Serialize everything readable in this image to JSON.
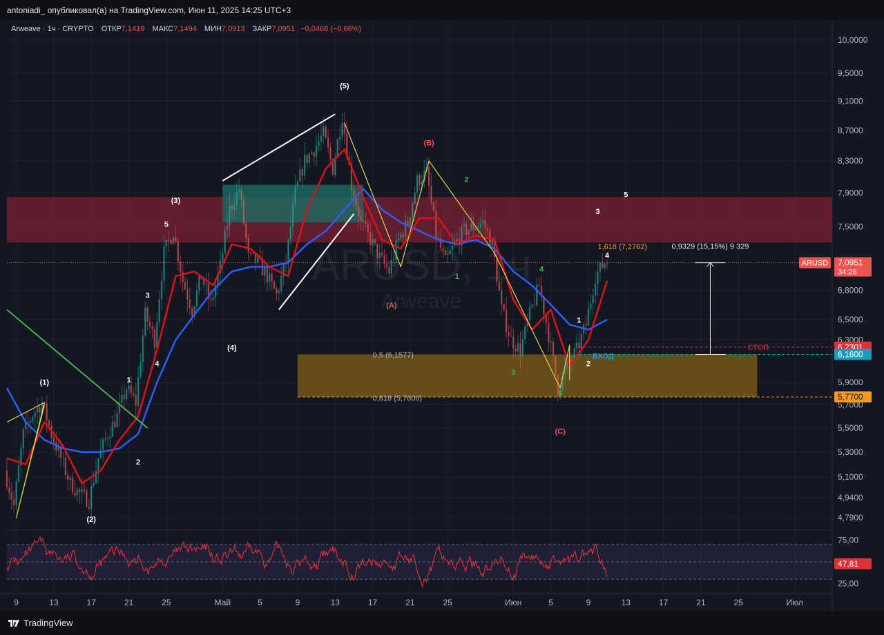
{
  "header": {
    "publisher_line": "antoniadi_ опубликовал(а) на TradingView.com, Июн 11, 2025 14:25 UTC+3"
  },
  "legend": {
    "symbol": "Arweave · 1ч · CRYPTO",
    "open_label": "ОТКР",
    "open": "7,1419",
    "high_label": "МАКС",
    "high": "7,1494",
    "low_label": "МИН",
    "low": "7,0913",
    "close_label": "ЗАКР",
    "close": "7,0951",
    "change": "−0,0468 (−0,66%)"
  },
  "watermark": {
    "ticker": "ARUSD, 1ч",
    "name": "Arweave"
  },
  "brand": {
    "name": "TradingView"
  },
  "colors": {
    "background": "#131722",
    "ema_fast": "#e0101a",
    "ema_slow": "#2f5bff",
    "resistance_zone": "#7a2232",
    "teal_zone": "#1b6b63",
    "buy_zone": "#7a5a18",
    "rsi_line": "#e0303a",
    "wave_line": "#e3d646",
    "trend_line": "#ffffff",
    "price_tag": "#ef5350",
    "entry_tag": "#1e9bbc",
    "stop_tag": "#e0303a",
    "fib_tag": "#f79a1e"
  },
  "chart_data": {
    "type": "candlestick",
    "symbol": "ARUSD",
    "timeframe": "1ч",
    "y_scale": "log",
    "ylim": [
      4.7,
      10.3
    ],
    "x_date_range": [
      "2025-04-08",
      "2025-07-05"
    ],
    "x_ticks": [
      {
        "date": "2025-04-09",
        "label": "9"
      },
      {
        "date": "2025-04-13",
        "label": "13"
      },
      {
        "date": "2025-04-17",
        "label": "17"
      },
      {
        "date": "2025-04-21",
        "label": "21"
      },
      {
        "date": "2025-04-25",
        "label": "25"
      },
      {
        "date": "2025-05-01",
        "label": "Май"
      },
      {
        "date": "2025-05-05",
        "label": "5"
      },
      {
        "date": "2025-05-09",
        "label": "9"
      },
      {
        "date": "2025-05-13",
        "label": "13"
      },
      {
        "date": "2025-05-17",
        "label": "17"
      },
      {
        "date": "2025-05-21",
        "label": "21"
      },
      {
        "date": "2025-05-25",
        "label": "25"
      },
      {
        "date": "2025-06-01",
        "label": "Июн"
      },
      {
        "date": "2025-06-05",
        "label": "5"
      },
      {
        "date": "2025-06-09",
        "label": "9"
      },
      {
        "date": "2025-06-13",
        "label": "13"
      },
      {
        "date": "2025-06-17",
        "label": "17"
      },
      {
        "date": "2025-06-21",
        "label": "21"
      },
      {
        "date": "2025-06-25",
        "label": "25"
      },
      {
        "date": "2025-07-01",
        "label": "Июл"
      }
    ],
    "y_ticks": [
      "10,0000",
      "9,5000",
      "9,1000",
      "8,7000",
      "8,3000",
      "7,9000",
      "7,5000",
      "6,8000",
      "6,5000",
      "6,3000",
      "5,9000",
      "5,7000",
      "5,5000",
      "5,3000",
      "5,1000",
      "4,9400",
      "4,7900"
    ],
    "y_tick_values": [
      10.0,
      9.5,
      9.1,
      8.7,
      8.3,
      7.9,
      7.5,
      6.8,
      6.5,
      6.3,
      5.9,
      5.7,
      5.5,
      5.3,
      5.1,
      4.94,
      4.79
    ],
    "price_path": [
      [
        "2025-04-08",
        5.15
      ],
      [
        "2025-04-09",
        4.88
      ],
      [
        "2025-04-10",
        5.45
      ],
      [
        "2025-04-11",
        5.62
      ],
      [
        "2025-04-12",
        5.72
      ],
      [
        "2025-04-13",
        5.45
      ],
      [
        "2025-04-14",
        5.25
      ],
      [
        "2025-04-15",
        5.05
      ],
      [
        "2025-04-16",
        4.97
      ],
      [
        "2025-04-17",
        4.92
      ],
      [
        "2025-04-18",
        5.25
      ],
      [
        "2025-04-19",
        5.45
      ],
      [
        "2025-04-20",
        5.6
      ],
      [
        "2025-04-21",
        5.85
      ],
      [
        "2025-04-22",
        5.72
      ],
      [
        "2025-04-23",
        6.55
      ],
      [
        "2025-04-24",
        6.3
      ],
      [
        "2025-04-25",
        7.2
      ],
      [
        "2025-04-26",
        7.45
      ],
      [
        "2025-04-27",
        6.9
      ],
      [
        "2025-04-28",
        6.6
      ],
      [
        "2025-04-29",
        6.95
      ],
      [
        "2025-04-30",
        6.65
      ],
      [
        "2025-05-01",
        7.05
      ],
      [
        "2025-05-02",
        7.7
      ],
      [
        "2025-05-03",
        7.95
      ],
      [
        "2025-05-04",
        7.15
      ],
      [
        "2025-05-05",
        7.1
      ],
      [
        "2025-05-06",
        6.95
      ],
      [
        "2025-05-07",
        6.75
      ],
      [
        "2025-05-08",
        7.1
      ],
      [
        "2025-05-09",
        7.9
      ],
      [
        "2025-05-10",
        8.3
      ],
      [
        "2025-05-11",
        8.45
      ],
      [
        "2025-05-12",
        8.65
      ],
      [
        "2025-05-13",
        8.2
      ],
      [
        "2025-05-14",
        8.9
      ],
      [
        "2025-05-15",
        8.0
      ],
      [
        "2025-05-16",
        7.55
      ],
      [
        "2025-05-17",
        7.35
      ],
      [
        "2025-05-18",
        7.15
      ],
      [
        "2025-05-19",
        7.0
      ],
      [
        "2025-05-20",
        7.35
      ],
      [
        "2025-05-21",
        7.55
      ],
      [
        "2025-05-22",
        8.05
      ],
      [
        "2025-05-23",
        8.15
      ],
      [
        "2025-05-24",
        7.4
      ],
      [
        "2025-05-25",
        7.1
      ],
      [
        "2025-05-26",
        7.3
      ],
      [
        "2025-05-27",
        7.45
      ],
      [
        "2025-05-28",
        7.5
      ],
      [
        "2025-05-29",
        7.55
      ],
      [
        "2025-05-30",
        7.3
      ],
      [
        "2025-05-31",
        6.6
      ],
      [
        "2025-06-01",
        6.3
      ],
      [
        "2025-06-02",
        6.2
      ],
      [
        "2025-06-03",
        6.55
      ],
      [
        "2025-06-04",
        6.85
      ],
      [
        "2025-06-05",
        6.35
      ],
      [
        "2025-06-06",
        5.85
      ],
      [
        "2025-06-07",
        6.05
      ],
      [
        "2025-06-08",
        6.2
      ],
      [
        "2025-06-09",
        6.45
      ],
      [
        "2025-06-10",
        6.95
      ],
      [
        "2025-06-11",
        7.1
      ]
    ],
    "ema_fast_path": [
      [
        "2025-04-08",
        5.25
      ],
      [
        "2025-04-10",
        5.2
      ],
      [
        "2025-04-12",
        5.55
      ],
      [
        "2025-04-14",
        5.35
      ],
      [
        "2025-04-16",
        5.05
      ],
      [
        "2025-04-18",
        5.15
      ],
      [
        "2025-04-20",
        5.4
      ],
      [
        "2025-04-22",
        5.6
      ],
      [
        "2025-04-24",
        6.2
      ],
      [
        "2025-04-26",
        6.95
      ],
      [
        "2025-04-28",
        7.0
      ],
      [
        "2025-04-30",
        6.85
      ],
      [
        "2025-05-02",
        7.3
      ],
      [
        "2025-05-04",
        7.25
      ],
      [
        "2025-05-06",
        7.05
      ],
      [
        "2025-05-08",
        6.95
      ],
      [
        "2025-05-10",
        7.7
      ],
      [
        "2025-05-12",
        8.2
      ],
      [
        "2025-05-14",
        8.45
      ],
      [
        "2025-05-16",
        7.85
      ],
      [
        "2025-05-18",
        7.35
      ],
      [
        "2025-05-20",
        7.25
      ],
      [
        "2025-05-22",
        7.6
      ],
      [
        "2025-05-24",
        7.6
      ],
      [
        "2025-05-26",
        7.3
      ],
      [
        "2025-05-28",
        7.4
      ],
      [
        "2025-05-30",
        7.35
      ],
      [
        "2025-06-01",
        6.7
      ],
      [
        "2025-06-03",
        6.4
      ],
      [
        "2025-06-05",
        6.6
      ],
      [
        "2025-06-07",
        6.05
      ],
      [
        "2025-06-09",
        6.3
      ],
      [
        "2025-06-11",
        6.9
      ]
    ],
    "ema_slow_path": [
      [
        "2025-04-08",
        5.85
      ],
      [
        "2025-04-10",
        5.55
      ],
      [
        "2025-04-12",
        5.4
      ],
      [
        "2025-04-14",
        5.33
      ],
      [
        "2025-04-16",
        5.3
      ],
      [
        "2025-04-18",
        5.3
      ],
      [
        "2025-04-20",
        5.33
      ],
      [
        "2025-04-22",
        5.45
      ],
      [
        "2025-04-24",
        5.9
      ],
      [
        "2025-04-26",
        6.3
      ],
      [
        "2025-04-28",
        6.55
      ],
      [
        "2025-04-30",
        6.8
      ],
      [
        "2025-05-02",
        7.0
      ],
      [
        "2025-05-04",
        7.05
      ],
      [
        "2025-05-06",
        7.05
      ],
      [
        "2025-05-08",
        7.1
      ],
      [
        "2025-05-10",
        7.3
      ],
      [
        "2025-05-12",
        7.45
      ],
      [
        "2025-05-14",
        7.7
      ],
      [
        "2025-05-16",
        7.95
      ],
      [
        "2025-05-18",
        7.7
      ],
      [
        "2025-05-20",
        7.55
      ],
      [
        "2025-05-22",
        7.45
      ],
      [
        "2025-05-24",
        7.35
      ],
      [
        "2025-05-26",
        7.3
      ],
      [
        "2025-05-28",
        7.35
      ],
      [
        "2025-05-30",
        7.25
      ],
      [
        "2025-06-01",
        7.0
      ],
      [
        "2025-06-03",
        6.85
      ],
      [
        "2025-06-05",
        6.65
      ],
      [
        "2025-06-07",
        6.45
      ],
      [
        "2025-06-09",
        6.4
      ],
      [
        "2025-06-11",
        6.5
      ]
    ],
    "zones": [
      {
        "name": "resistance",
        "from": "2025-04-08",
        "to": "2025-07-05",
        "low": 7.32,
        "high": 7.85
      },
      {
        "name": "teal",
        "from": "2025-05-01",
        "to": "2025-05-16",
        "low": 7.55,
        "high": 8.0
      },
      {
        "name": "buy",
        "from": "2025-05-09",
        "to": "2025-06-27",
        "low": 5.77,
        "high": 6.16
      }
    ],
    "levels": [
      {
        "name": "current",
        "value": 7.0951,
        "label": "ARUSD",
        "value_label": "7,0951",
        "countdown": "34:26"
      },
      {
        "name": "stop",
        "value": 6.2301,
        "label": "СТОП",
        "value_label": "6,2301"
      },
      {
        "name": "entry",
        "value": 6.16,
        "label": "ВХОД",
        "value_label": "6,1600"
      },
      {
        "name": "target",
        "value": 5.77,
        "value_label": "5,7700"
      }
    ],
    "fib_labels": [
      {
        "date": "2025-05-17",
        "value": 6.1577,
        "text": "0,5 (6,1577)"
      },
      {
        "date": "2025-05-17",
        "value": 5.7608,
        "text": "0,618 (5,7608)"
      },
      {
        "date": "2025-06-10",
        "value": 7.2762,
        "text": "1,618 (7,2762)"
      }
    ],
    "measure": {
      "date": "2025-06-22",
      "from": 6.16,
      "to": 7.0951,
      "text": "0,9329 (15,15%) 9 329"
    },
    "wave_labels": [
      {
        "text": "(1)",
        "date": "2025-04-12",
        "value": 5.88,
        "color": "#ffffff"
      },
      {
        "text": "(2)",
        "date": "2025-04-17",
        "value": 4.76,
        "color": "#ffffff"
      },
      {
        "text": "(3)",
        "date": "2025-04-26",
        "value": 7.78,
        "color": "#ffffff"
      },
      {
        "text": "(4)",
        "date": "2025-05-02",
        "value": 6.2,
        "color": "#ffffff"
      },
      {
        "text": "(5)",
        "date": "2025-05-14",
        "value": 9.28,
        "color": "#ffffff"
      },
      {
        "text": "(A)",
        "date": "2025-05-19",
        "value": 6.62,
        "color": "#ef5350"
      },
      {
        "text": "(B)",
        "date": "2025-05-23",
        "value": 8.5,
        "color": "#ef5350"
      },
      {
        "text": "(C)",
        "date": "2025-06-06",
        "value": 5.45,
        "color": "#ef5350"
      },
      {
        "text": "1",
        "date": "2025-04-21",
        "value": 5.9,
        "color": "#ffffff"
      },
      {
        "text": "2",
        "date": "2025-04-22",
        "value": 5.2,
        "color": "#ffffff"
      },
      {
        "text": "3",
        "date": "2025-04-23",
        "value": 6.72,
        "color": "#ffffff"
      },
      {
        "text": "4",
        "date": "2025-04-24",
        "value": 6.05,
        "color": "#ffffff"
      },
      {
        "text": "5",
        "date": "2025-04-25",
        "value": 7.5,
        "color": "#ffffff"
      },
      {
        "text": "1",
        "date": "2025-05-26",
        "value": 6.92,
        "color": "#4caf50"
      },
      {
        "text": "2",
        "date": "2025-05-27",
        "value": 8.03,
        "color": "#4caf50"
      },
      {
        "text": "3",
        "date": "2025-06-01",
        "value": 5.97,
        "color": "#4caf50"
      },
      {
        "text": "4",
        "date": "2025-06-04",
        "value": 7.0,
        "color": "#4caf50"
      },
      {
        "text": "5",
        "date": "2025-06-06",
        "value": 5.78,
        "color": "#4caf50"
      },
      {
        "text": "1",
        "date": "2025-06-08",
        "value": 6.47,
        "color": "#ffffff"
      },
      {
        "text": "2",
        "date": "2025-06-09",
        "value": 6.05,
        "color": "#ffffff"
      },
      {
        "text": "3",
        "date": "2025-06-10",
        "value": 7.65,
        "color": "#ffffff"
      },
      {
        "text": "4",
        "date": "2025-06-11",
        "value": 7.15,
        "color": "#ffffff"
      },
      {
        "text": "5",
        "date": "2025-06-13",
        "value": 7.85,
        "color": "#ffffff"
      }
    ],
    "trend_lines": [
      {
        "color": "#ffffff",
        "points": [
          [
            "2025-05-01",
            8.05
          ],
          [
            "2025-05-13",
            8.92
          ]
        ]
      },
      {
        "color": "#ffffff",
        "points": [
          [
            "2025-05-07",
            6.6
          ],
          [
            "2025-05-15",
            7.65
          ]
        ]
      },
      {
        "color": "#4caf50",
        "points": [
          [
            "2025-04-08",
            6.6
          ],
          [
            "2025-04-23",
            5.5
          ]
        ]
      }
    ],
    "wave_lines": [
      {
        "color": "#e3d646",
        "points": [
          [
            "2025-04-08",
            5.55
          ],
          [
            "2025-04-12",
            5.72
          ],
          [
            "2025-04-09",
            4.79
          ],
          [
            "2025-04-12",
            5.7
          ]
        ]
      },
      {
        "color": "#e3d646",
        "points": [
          [
            "2025-05-14",
            8.8
          ],
          [
            "2025-05-20",
            7.05
          ],
          [
            "2025-05-23",
            8.3
          ],
          [
            "2025-05-30",
            7.2
          ],
          [
            "2025-06-06",
            5.85
          ],
          [
            "2025-06-07",
            6.25
          ],
          [
            "2025-06-07",
            5.92
          ]
        ]
      }
    ],
    "rsi": {
      "label": "47,81",
      "value": 47.81,
      "range": [
        15,
        85
      ],
      "ticks": [
        "75,00",
        "25,00"
      ],
      "tick_values": [
        75,
        25
      ],
      "upper_band": 70,
      "lower_band": 30
    }
  }
}
